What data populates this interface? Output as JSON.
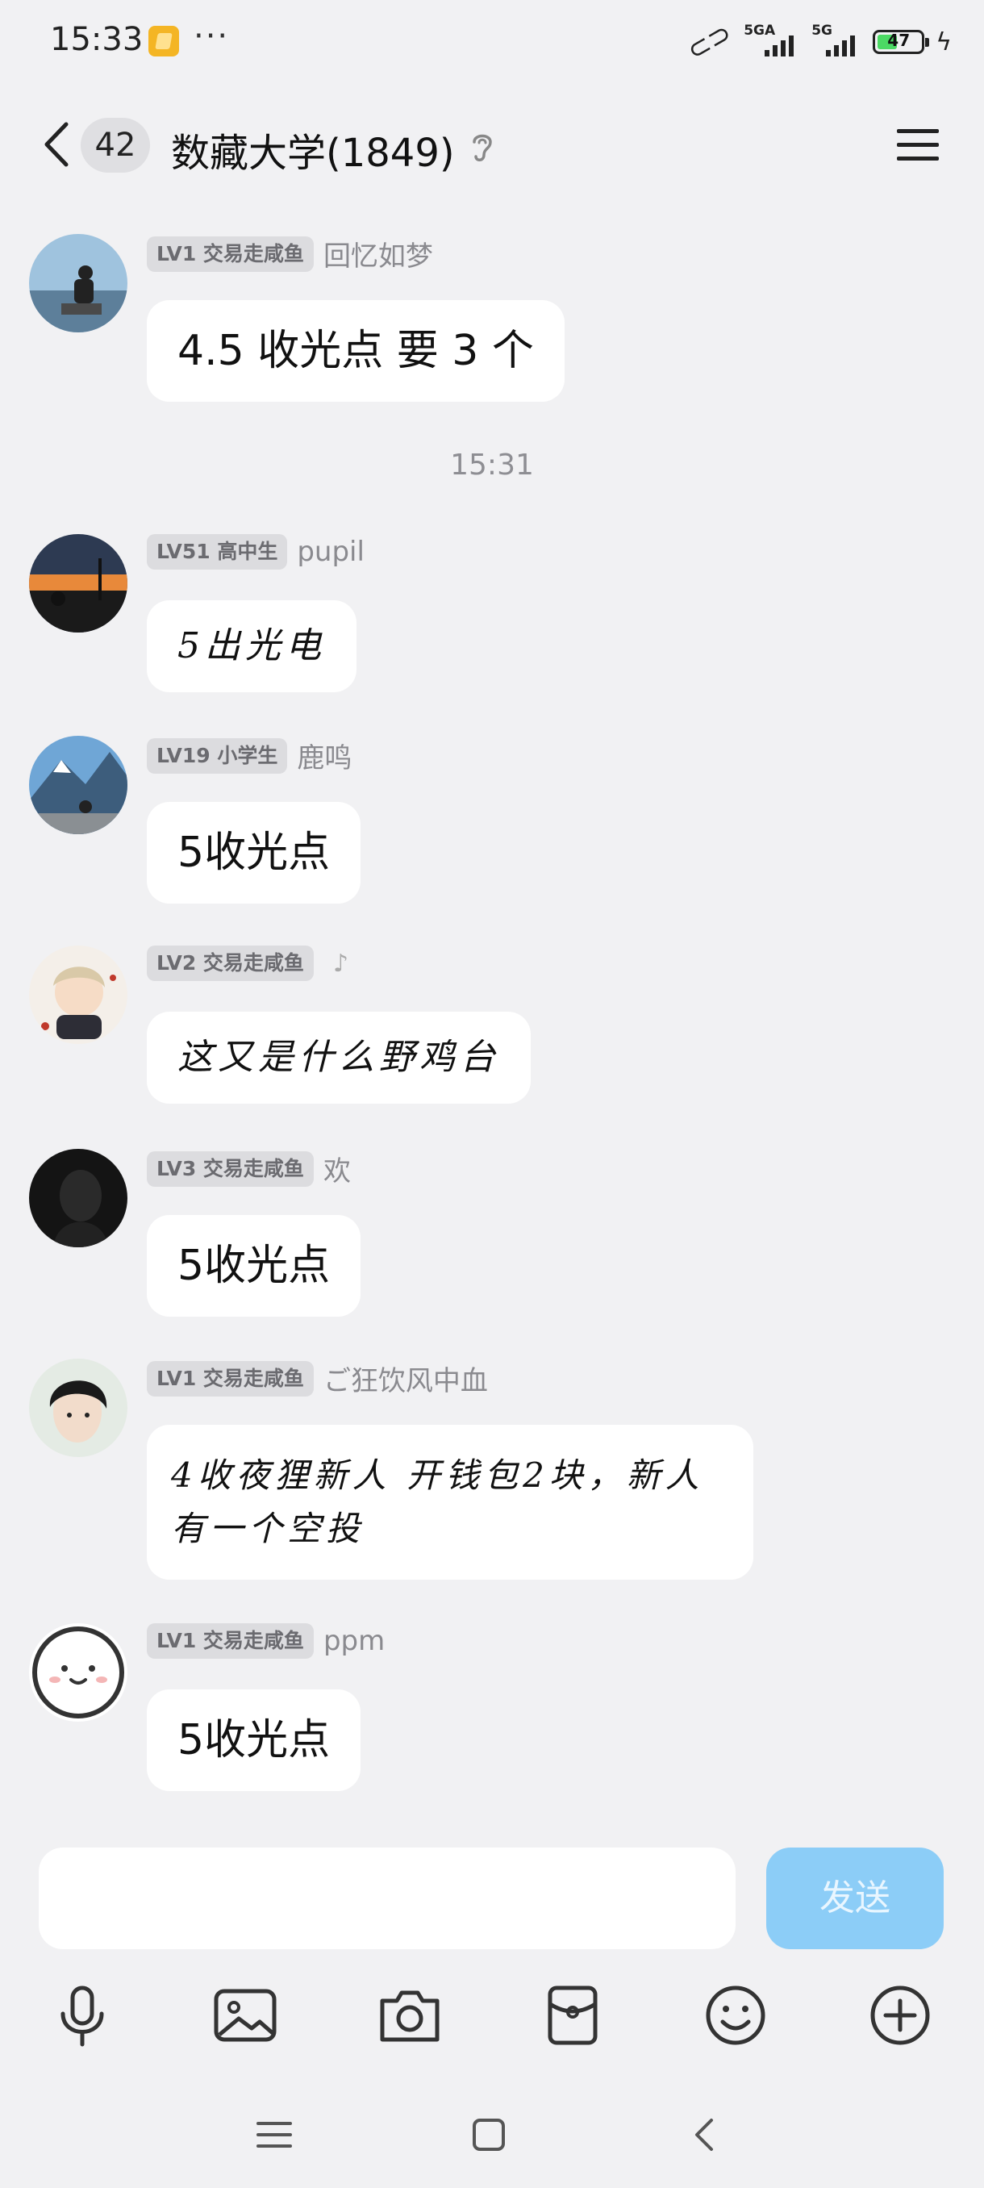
{
  "status_bar": {
    "time": "15:33",
    "dots": "···",
    "signal1_label": "5GA",
    "signal2_label": "5G",
    "battery": "47",
    "battery_level": 0.47
  },
  "header": {
    "unread_count": "42",
    "title": "数藏大学(1849)"
  },
  "messages": [
    {
      "level": "LV1 交易走咸鱼",
      "nick": "回忆如梦",
      "text": "4.5 收光点 要 3 个"
    },
    {
      "level": "LV51 高中生",
      "nick": "pupil",
      "text": "5出光电"
    },
    {
      "level": "LV19 小学生",
      "nick": "鹿鸣",
      "text": "5收光点"
    },
    {
      "level": "LV2 交易走咸鱼",
      "nick": "",
      "text": "这又是什么野鸡台"
    },
    {
      "level": "LV3 交易走咸鱼",
      "nick": "欢",
      "text": "5收光点"
    },
    {
      "level": "LV1 交易走咸鱼",
      "nick": "ご狂饮风中血",
      "text": "4收夜狸新人  开钱包2块，新人有一个空投"
    },
    {
      "level": "LV1 交易走咸鱼",
      "nick": "ppm",
      "text": "5收光点"
    }
  ],
  "timestamp": "15:31",
  "input": {
    "value": "",
    "send_label": "发送"
  },
  "colors": {
    "background": "#f1f1f3",
    "send_button": "#8ccdf7",
    "bubble": "#ffffff",
    "level_badge": "#dcdcdf"
  },
  "icons": {
    "toolbar": [
      "microphone-icon",
      "image-icon",
      "camera-icon",
      "red-packet-icon",
      "emoji-icon",
      "plus-icon"
    ],
    "nav": [
      "menu-icon",
      "home-icon",
      "back-icon"
    ]
  }
}
